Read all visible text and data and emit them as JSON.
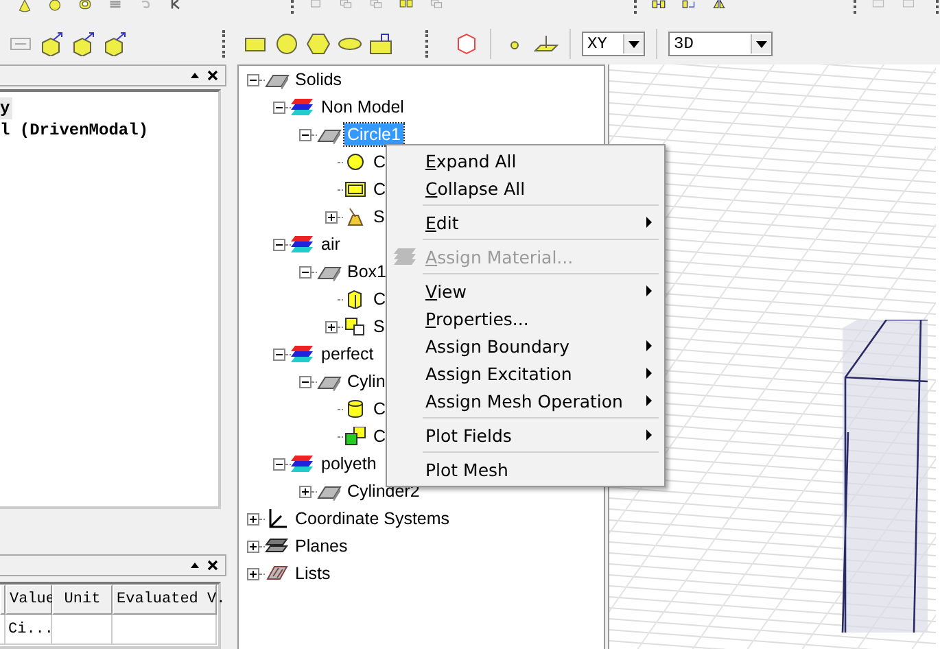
{
  "toolbar": {
    "plane_dropdown": {
      "value": "XY"
    },
    "view_dropdown": {
      "value": "3D"
    }
  },
  "project_panel": {
    "lines": [
      {
        "text": "y",
        "selected": true
      },
      {
        "text": "l (DrivenModal)",
        "selected": false
      }
    ]
  },
  "properties_panel": {
    "table": {
      "columns": [
        "Value",
        "Unit",
        "Evaluated V."
      ],
      "rows": [
        [
          "Ci...",
          "",
          ""
        ]
      ]
    }
  },
  "tree": {
    "nodes": [
      {
        "label": "Solids",
        "kind": "solid",
        "selected": false,
        "expanded": true,
        "children": [
          {
            "label": "Non Model",
            "kind": "material",
            "selected": false,
            "expanded": true,
            "children": [
              {
                "label": "Circle1",
                "kind": "solid",
                "selected": true,
                "expanded": true,
                "children": [
                  {
                    "label": "C",
                    "kind": "circle",
                    "selected": false
                  },
                  {
                    "label": "C",
                    "kind": "rectangle",
                    "selected": false
                  },
                  {
                    "label": "S",
                    "kind": "sweep",
                    "selected": false,
                    "expanded": false
                  }
                ]
              }
            ]
          },
          {
            "label": "air",
            "kind": "material",
            "selected": false,
            "expanded": true,
            "children": [
              {
                "label": "Box1",
                "kind": "solid",
                "selected": false,
                "expanded": true,
                "children": [
                  {
                    "label": "C",
                    "kind": "box",
                    "selected": false
                  },
                  {
                    "label": "S",
                    "kind": "squares",
                    "selected": false,
                    "expanded": false
                  }
                ]
              }
            ]
          },
          {
            "label": "perfect",
            "kind": "material",
            "selected": false,
            "expanded": true,
            "children": [
              {
                "label": "Cylin",
                "kind": "solid",
                "selected": false,
                "expanded": true,
                "children": [
                  {
                    "label": "C",
                    "kind": "cylinder",
                    "selected": false
                  },
                  {
                    "label": "C",
                    "kind": "green-squares",
                    "selected": false
                  }
                ]
              }
            ]
          },
          {
            "label": "polyeth",
            "kind": "material",
            "selected": false,
            "expanded": true,
            "children": [
              {
                "label": "Cylinder2",
                "kind": "solid",
                "selected": false,
                "expanded": false
              }
            ]
          }
        ]
      },
      {
        "label": "Coordinate Systems",
        "kind": "axes",
        "selected": false,
        "expanded": false
      },
      {
        "label": "Planes",
        "kind": "planes",
        "selected": false,
        "expanded": false
      },
      {
        "label": "Lists",
        "kind": "lists",
        "selected": false,
        "expanded": false
      }
    ]
  },
  "context_menu": {
    "groups": [
      [
        {
          "label": "Expand All",
          "mnemonic": true,
          "submenu": false,
          "disabled": false
        },
        {
          "label": "Collapse All",
          "mnemonic": true,
          "submenu": false,
          "disabled": false
        }
      ],
      [
        {
          "label": "Edit",
          "mnemonic": true,
          "submenu": true,
          "disabled": false
        }
      ],
      [
        {
          "label": "Assign Material...",
          "mnemonic": true,
          "submenu": false,
          "disabled": true,
          "icon": true
        }
      ],
      [
        {
          "label": "View",
          "mnemonic": true,
          "submenu": true,
          "disabled": false
        },
        {
          "label": "Properties...",
          "mnemonic": true,
          "submenu": false,
          "disabled": false
        },
        {
          "label": "Assign Boundary",
          "mnemonic": false,
          "submenu": true,
          "disabled": false
        },
        {
          "label": "Assign Excitation",
          "mnemonic": false,
          "submenu": true,
          "disabled": false
        },
        {
          "label": "Assign Mesh Operation",
          "mnemonic": false,
          "submenu": true,
          "disabled": false
        }
      ],
      [
        {
          "label": "Plot Fields",
          "mnemonic": false,
          "submenu": true,
          "disabled": false
        }
      ],
      [
        {
          "label": "Plot Mesh",
          "mnemonic": false,
          "submenu": false,
          "disabled": false
        }
      ]
    ]
  }
}
